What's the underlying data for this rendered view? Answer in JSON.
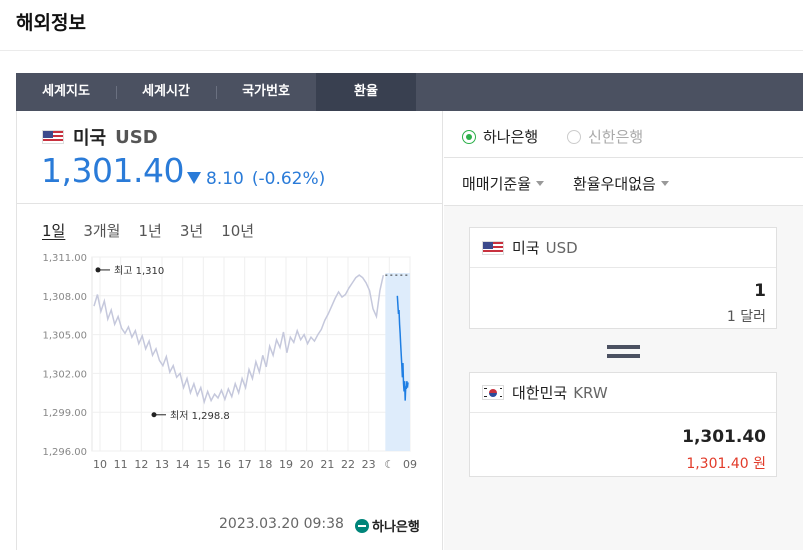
{
  "page_title": "해외정보",
  "tabs": [
    {
      "label": "세계지도",
      "active": false
    },
    {
      "label": "세계시간",
      "active": false
    },
    {
      "label": "국가번호",
      "active": false
    },
    {
      "label": "환율",
      "active": true
    }
  ],
  "currency": {
    "name": "미국",
    "code": "USD",
    "rate": "1,301.40",
    "change": "8.10",
    "change_pct": "(-0.62%)",
    "direction": "down",
    "color": "#2a7bd8"
  },
  "periods": [
    {
      "label": "1일",
      "active": true
    },
    {
      "label": "3개월",
      "active": false
    },
    {
      "label": "1년",
      "active": false
    },
    {
      "label": "3년",
      "active": false
    },
    {
      "label": "10년",
      "active": false
    }
  ],
  "chart_data": {
    "type": "line",
    "y_ticks": [
      "1,311.00",
      "1,308.00",
      "1,305.00",
      "1,302.00",
      "1,299.00",
      "1,296.00"
    ],
    "ylim": [
      1296,
      1311
    ],
    "x_ticks": [
      "10",
      "11",
      "12",
      "13",
      "14",
      "15",
      "16",
      "17",
      "18",
      "19",
      "20",
      "21",
      "22",
      "23",
      "☾",
      "09"
    ],
    "high_label": "최고 1,310",
    "low_label": "최저 1,298.8",
    "high": 1310,
    "low": 1298.8,
    "series": [
      {
        "values": [
          1307.2,
          1308.1,
          1306.8,
          1307.6,
          1306.2,
          1306.9,
          1305.8,
          1306.4,
          1305.5,
          1305.1,
          1305.6,
          1304.8,
          1305.3,
          1304.3,
          1304.9,
          1303.9,
          1304.5,
          1303.4,
          1303.9,
          1303.0,
          1302.6,
          1303.3,
          1302.1,
          1302.6,
          1301.7,
          1302.0,
          1300.9,
          1301.6,
          1300.5,
          1301.2,
          1300.3,
          1300.9,
          1299.8,
          1300.6,
          1299.9,
          1300.4,
          1300.1,
          1300.7,
          1300.0,
          1300.8,
          1300.2,
          1301.2,
          1300.5,
          1301.6,
          1300.9,
          1302.3,
          1301.6,
          1302.9,
          1302.1,
          1303.4,
          1302.5,
          1304.1,
          1303.4,
          1304.6,
          1304.0,
          1305.2,
          1303.6,
          1304.8,
          1304.4,
          1305.3,
          1304.6,
          1305.0,
          1304.3,
          1304.8,
          1304.5,
          1305.0,
          1305.4,
          1306.1,
          1306.6,
          1307.2,
          1307.8,
          1308.3,
          1307.9,
          1308.1,
          1308.6,
          1309.0,
          1309.4,
          1309.6,
          1309.4,
          1309.0,
          1308.4,
          1307.0,
          1306.4,
          1308.4,
          1309.6
        ],
        "color": "#c5c8dc"
      },
      {
        "values": [
          1308.0,
          1307.3,
          1306.6,
          1306.9,
          1305.8,
          1305.1,
          1304.2,
          1303.4,
          1302.6,
          1301.7,
          1302.8,
          1301.2,
          1300.6,
          1301.4,
          1299.9,
          1301.0,
          1300.8,
          1301.4,
          1300.9,
          1301.3
        ],
        "color": "#1e7ee3"
      }
    ]
  },
  "timestamp": "2023.03.20 09:38",
  "bank_logo": "하나은행",
  "banks": [
    {
      "label": "하나은행",
      "selected": true
    },
    {
      "label": "신한은행",
      "selected": false
    }
  ],
  "options": [
    {
      "label": "매매기준율"
    },
    {
      "label": "환율우대없음"
    }
  ],
  "from": {
    "name": "미국",
    "code": "USD",
    "value": "1",
    "sub": "1 달러"
  },
  "to": {
    "name": "대한민국",
    "code": "KRW",
    "value": "1,301.40",
    "sub": "1,301.40 원"
  }
}
